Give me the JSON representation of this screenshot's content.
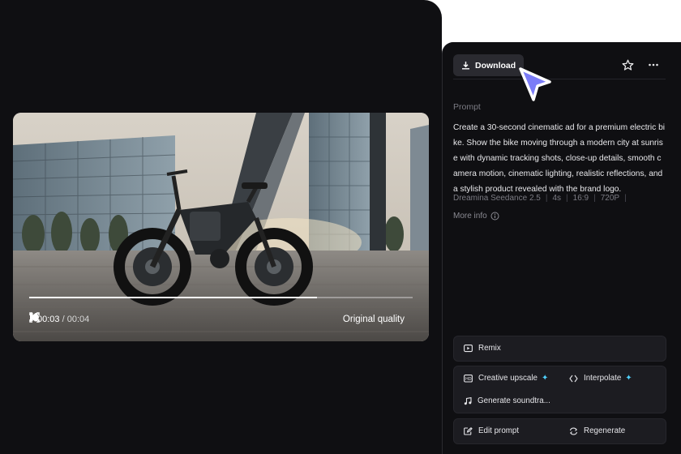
{
  "player": {
    "current_time": "00:03",
    "duration": "/ 00:04",
    "quality_label": "Original quality",
    "progress": 0.75
  },
  "toolbar": {
    "download_label": "Download"
  },
  "prompt": {
    "label": "Prompt",
    "text": "Create a 30-second cinematic ad for a premium electric bike. Show the bike moving through a modern city at sunrise with dynamic tracking shots, close-up details, smooth camera motion, cinematic lighting, realistic reflections, and a stylish product revealed with the brand logo."
  },
  "meta": {
    "model": "Dreamina Seedance 2.5",
    "duration": "4s",
    "ratio": "16:9",
    "resolution": "720P"
  },
  "more_info_label": "More info",
  "actions": {
    "remix": "Remix",
    "creative_upscale": "Creative upscale",
    "interpolate": "Interpolate",
    "generate_soundtrack": "Generate soundtra...",
    "edit_prompt": "Edit prompt",
    "regenerate": "Regenerate"
  },
  "colors": {
    "panel_bg": "#0f0f12",
    "button_bg": "#2a2a30",
    "accent_sparkle": "#4fd2ff",
    "cursor": "#7b7cf7"
  },
  "icons": {
    "play_state": "pause-icon",
    "volume": "volume-icon",
    "fullscreen": "fullscreen-icon",
    "download": "download-icon",
    "favorite": "star-icon",
    "more": "more-icon",
    "info": "info-icon"
  }
}
